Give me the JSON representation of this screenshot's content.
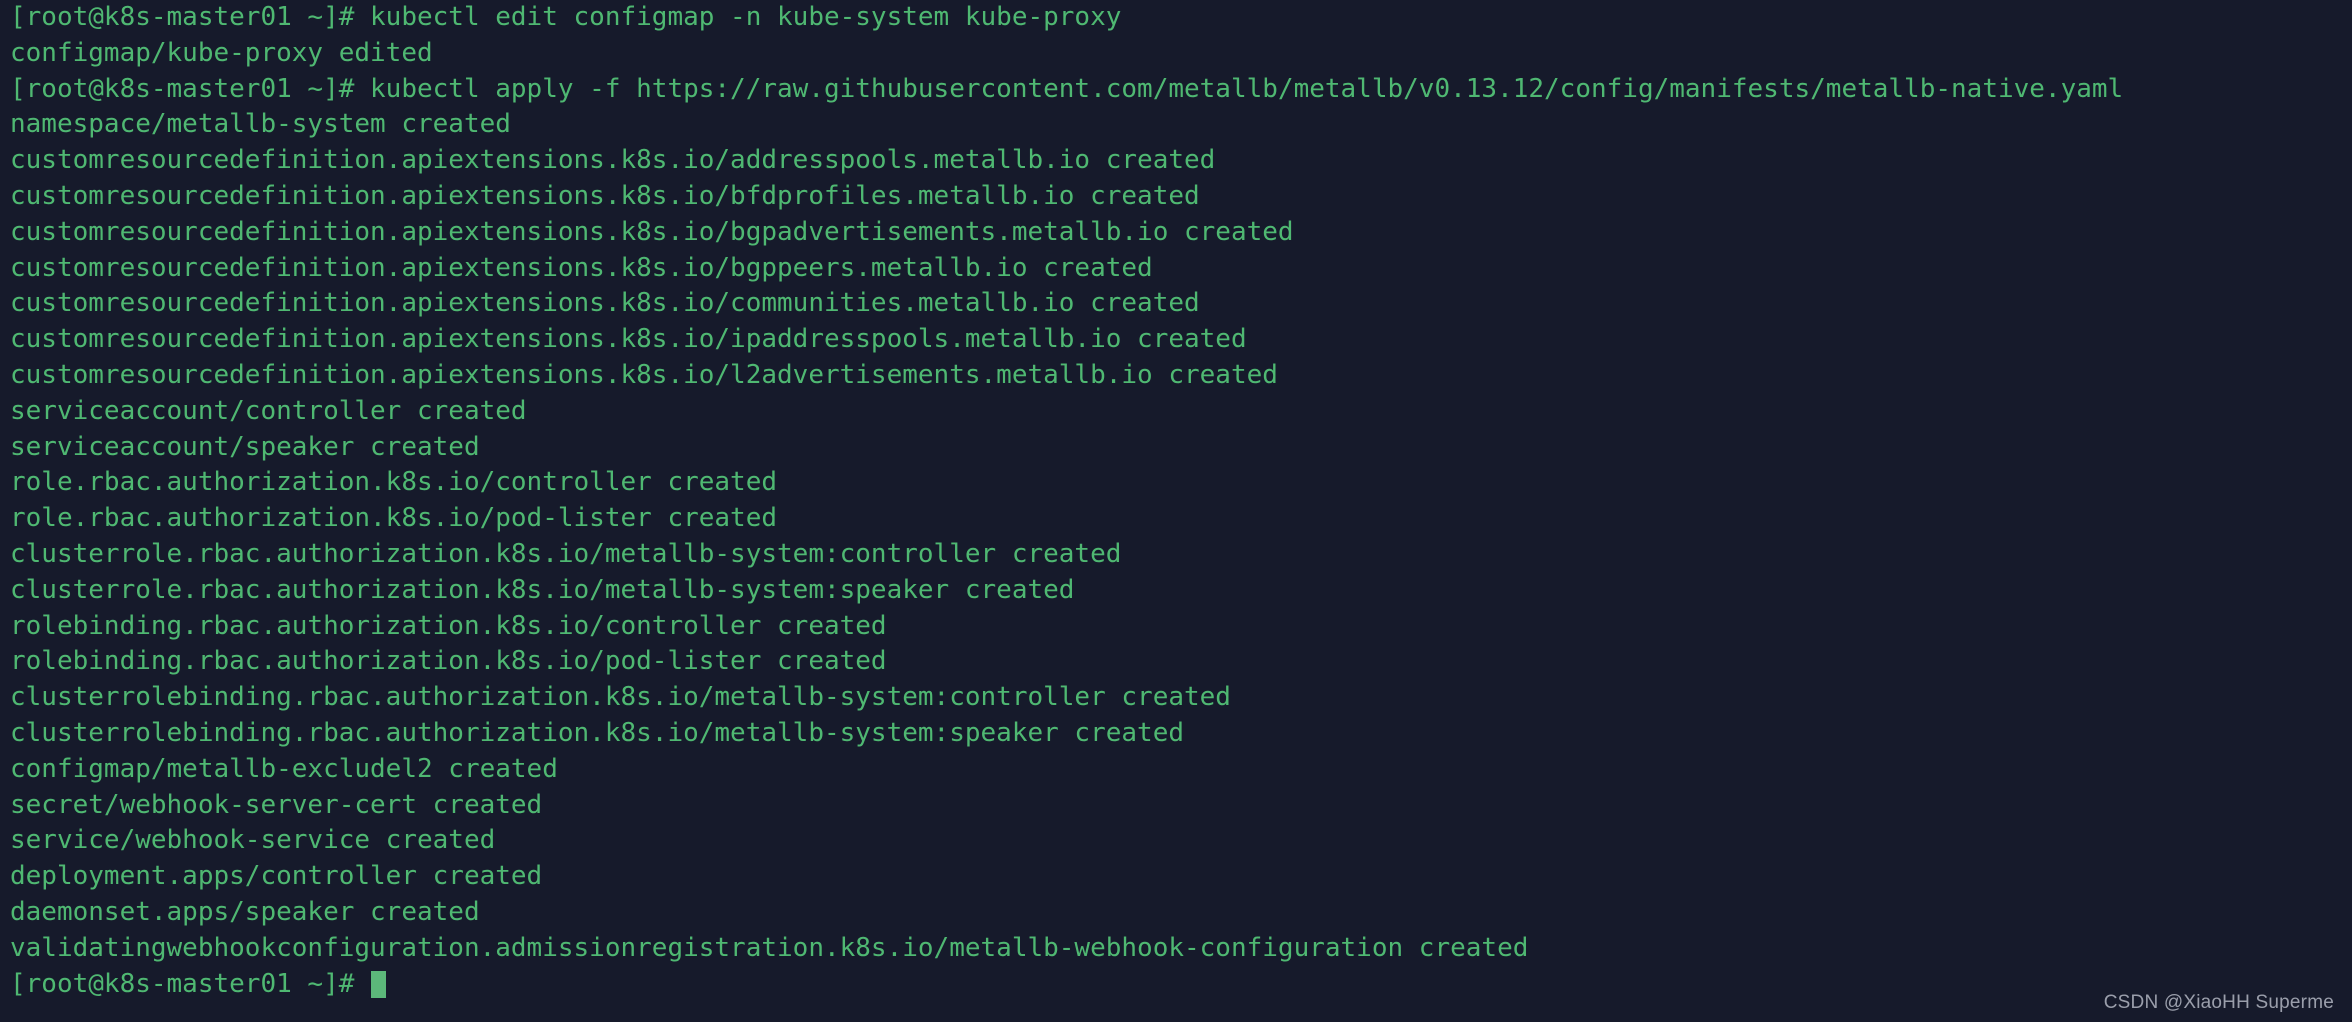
{
  "terminal": {
    "background_color": "#161a2b",
    "text_color": "#4fb872",
    "cursor_color": "#5cb87a",
    "prompt": "[root@k8s-master01 ~]#",
    "hostname": "k8s-master01",
    "user": "root",
    "cwd": "~",
    "lines": [
      "[root@k8s-master01 ~]# kubectl edit configmap -n kube-system kube-proxy",
      "configmap/kube-proxy edited",
      "[root@k8s-master01 ~]# kubectl apply -f https://raw.githubusercontent.com/metallb/metallb/v0.13.12/config/manifests/metallb-native.yaml",
      "namespace/metallb-system created",
      "customresourcedefinition.apiextensions.k8s.io/addresspools.metallb.io created",
      "customresourcedefinition.apiextensions.k8s.io/bfdprofiles.metallb.io created",
      "customresourcedefinition.apiextensions.k8s.io/bgpadvertisements.metallb.io created",
      "customresourcedefinition.apiextensions.k8s.io/bgppeers.metallb.io created",
      "customresourcedefinition.apiextensions.k8s.io/communities.metallb.io created",
      "customresourcedefinition.apiextensions.k8s.io/ipaddresspools.metallb.io created",
      "customresourcedefinition.apiextensions.k8s.io/l2advertisements.metallb.io created",
      "serviceaccount/controller created",
      "serviceaccount/speaker created",
      "role.rbac.authorization.k8s.io/controller created",
      "role.rbac.authorization.k8s.io/pod-lister created",
      "clusterrole.rbac.authorization.k8s.io/metallb-system:controller created",
      "clusterrole.rbac.authorization.k8s.io/metallb-system:speaker created",
      "rolebinding.rbac.authorization.k8s.io/controller created",
      "rolebinding.rbac.authorization.k8s.io/pod-lister created",
      "clusterrolebinding.rbac.authorization.k8s.io/metallb-system:controller created",
      "clusterrolebinding.rbac.authorization.k8s.io/metallb-system:speaker created",
      "configmap/metallb-excludel2 created",
      "secret/webhook-server-cert created",
      "service/webhook-service created",
      "deployment.apps/controller created",
      "daemonset.apps/speaker created",
      "validatingwebhookconfiguration.admissionregistration.k8s.io/metallb-webhook-configuration created"
    ],
    "final_prompt": "[root@k8s-master01 ~]# "
  },
  "watermark": {
    "text": "CSDN @XiaoHH Superme"
  }
}
